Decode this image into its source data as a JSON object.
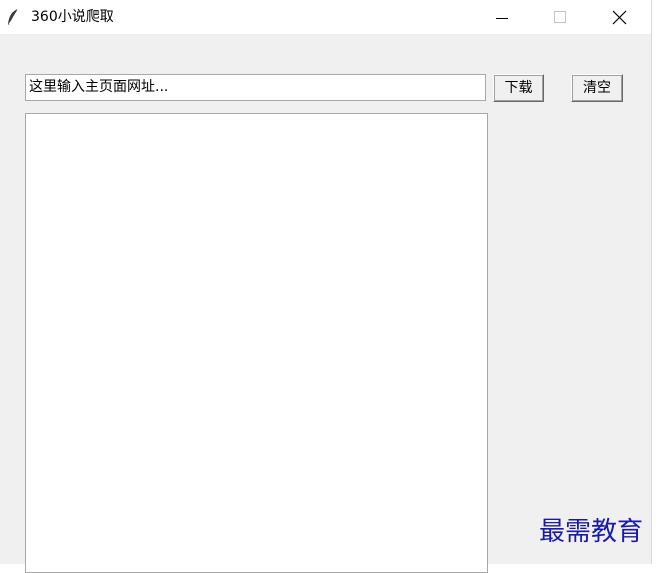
{
  "window": {
    "title": "360小说爬取"
  },
  "url_input": {
    "value": "这里输入主页面网址..."
  },
  "buttons": {
    "download_label": "下载",
    "clear_label": "清空"
  },
  "watermark": {
    "text": "最需教育"
  }
}
